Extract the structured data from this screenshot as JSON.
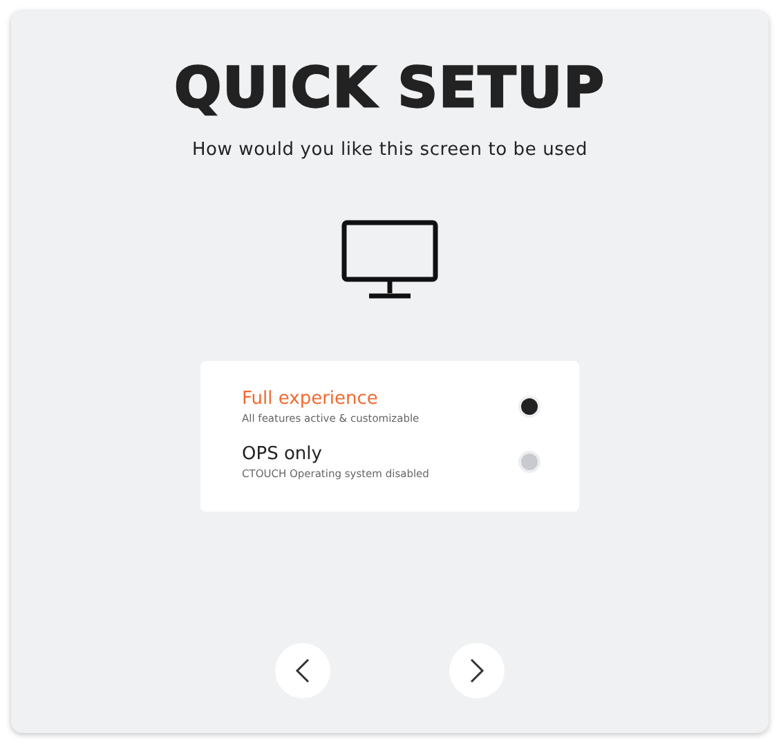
{
  "title": "QUICK SETUP",
  "subtitle": "How would you like this screen to be used",
  "options": [
    {
      "label": "Full experience",
      "description": "All features active & customizable",
      "selected": true
    },
    {
      "label": "OPS only",
      "description": "CTOUCH Operating system disabled",
      "selected": false
    }
  ]
}
